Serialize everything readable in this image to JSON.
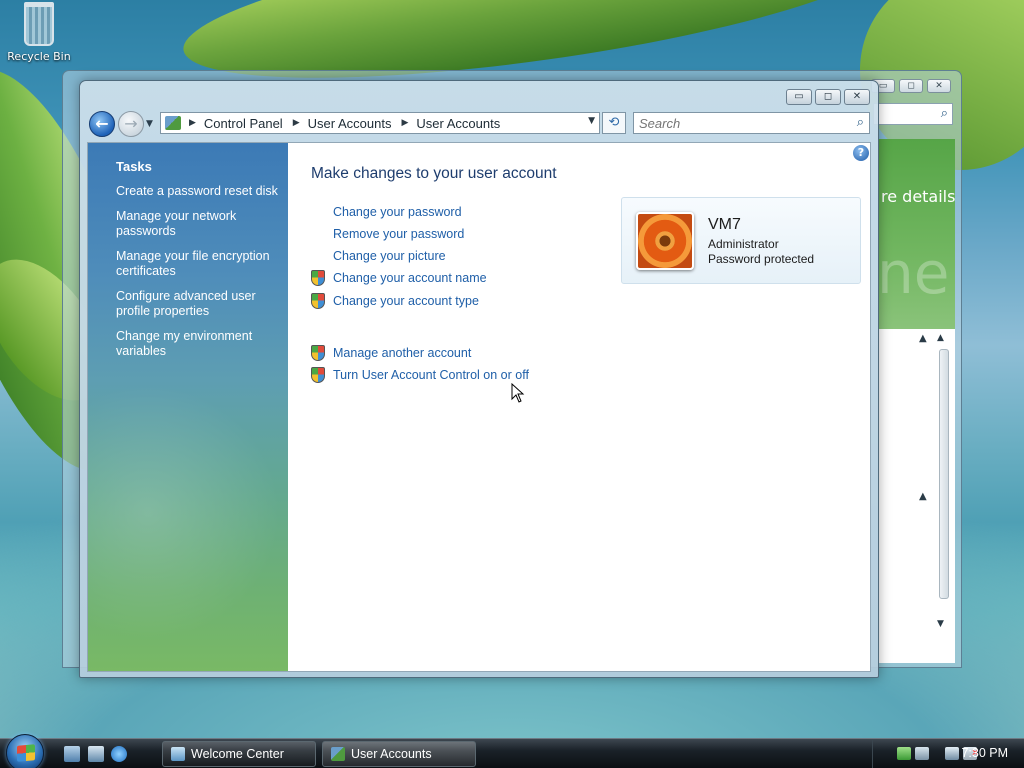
{
  "desktop": {
    "recycle_bin_label": "Recycle Bin"
  },
  "background_window": {
    "title_fragment": "re details",
    "big_text_fragment": "ne"
  },
  "window": {
    "controls": {
      "minimize": "▭",
      "maximize": "◻",
      "close": "✕"
    },
    "breadcrumbs": [
      "Control Panel",
      "User Accounts",
      "User Accounts"
    ],
    "search_placeholder": "Search",
    "help_label": "?"
  },
  "sidebar": {
    "heading": "Tasks",
    "items": [
      "Create a password reset disk",
      "Manage your network passwords",
      "Manage your file encryption certificates",
      "Configure advanced user profile properties",
      "Change my environment variables"
    ]
  },
  "main": {
    "heading": "Make changes to your user account",
    "links": [
      {
        "label": "Change your password",
        "shield": false
      },
      {
        "label": "Remove your password",
        "shield": false
      },
      {
        "label": "Change your picture",
        "shield": false
      },
      {
        "label": "Change your account name",
        "shield": true
      },
      {
        "label": "Change your account type",
        "shield": true
      }
    ],
    "links2": [
      {
        "label": "Manage another account",
        "shield": true
      },
      {
        "label": "Turn User Account Control on or off",
        "shield": true
      }
    ],
    "account": {
      "name": "VM7",
      "type": "Administrator",
      "status": "Password protected"
    }
  },
  "taskbar": {
    "buttons": [
      "Welcome Center",
      "User Accounts"
    ],
    "active_button": "User Accounts",
    "clock": "7:30 PM"
  },
  "colors": {
    "link": "#1f5fa8",
    "heading": "#1e3d6e",
    "sidebar_top": "#3c7ab6",
    "sidebar_bottom": "#79b965"
  }
}
